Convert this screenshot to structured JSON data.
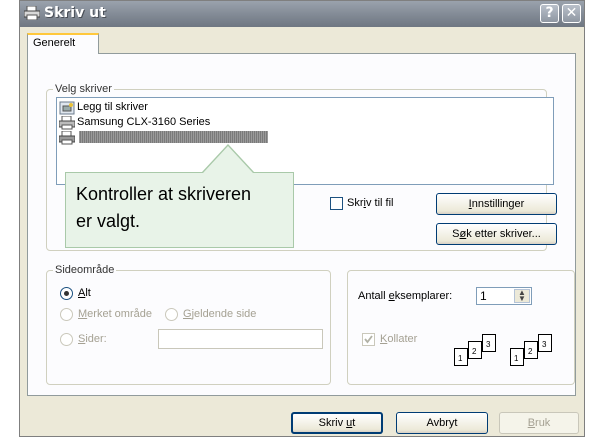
{
  "window": {
    "title": "Skriv ut",
    "help_glyph": "?",
    "close_glyph": "✕"
  },
  "tabs": [
    {
      "label": "Generelt"
    }
  ],
  "printer_group": {
    "legend": "Velg skriver",
    "items": [
      {
        "label": "Legg til skriver",
        "icon": "add-printer-icon"
      },
      {
        "label": "Samsung CLX-3160 Series",
        "icon": "printer-icon"
      },
      {
        "label": "",
        "icon": "printer-icon",
        "selected": true
      }
    ],
    "print_to_file": {
      "pre": "Skr",
      "u": "i",
      "post": "v til fil",
      "checked": false
    },
    "settings_button": {
      "pre": "",
      "u": "I",
      "post": "nnstillinger"
    },
    "find_button": {
      "pre": "S",
      "u": "ø",
      "post": "k etter skriver..."
    }
  },
  "callout": {
    "line1": "Kontroller at skriveren",
    "line2": "er valgt."
  },
  "range_group": {
    "legend": "Sideområde",
    "all": {
      "pre": "",
      "u": "A",
      "post": "lt",
      "selected": true
    },
    "selection": {
      "pre": "",
      "u": "M",
      "post": "erket område"
    },
    "current": {
      "pre": "",
      "u": "G",
      "post": "jeldende side"
    },
    "pages": {
      "pre": "",
      "u": "S",
      "post": "ider:",
      "value": ""
    }
  },
  "copies_group": {
    "copies_label": {
      "pre": "Antall ",
      "u": "e",
      "post": "ksemplarer:"
    },
    "copies_value": "1",
    "collate": {
      "pre": "",
      "u": "K",
      "post": "ollater",
      "checked": true
    },
    "collate_pages": [
      "1",
      "2",
      "3"
    ]
  },
  "footer": {
    "print": {
      "pre": "Skriv ",
      "u": "u",
      "post": "t"
    },
    "cancel": {
      "label": "Avbryt"
    },
    "apply": {
      "pre": "",
      "u": "B",
      "post": "ruk"
    }
  }
}
